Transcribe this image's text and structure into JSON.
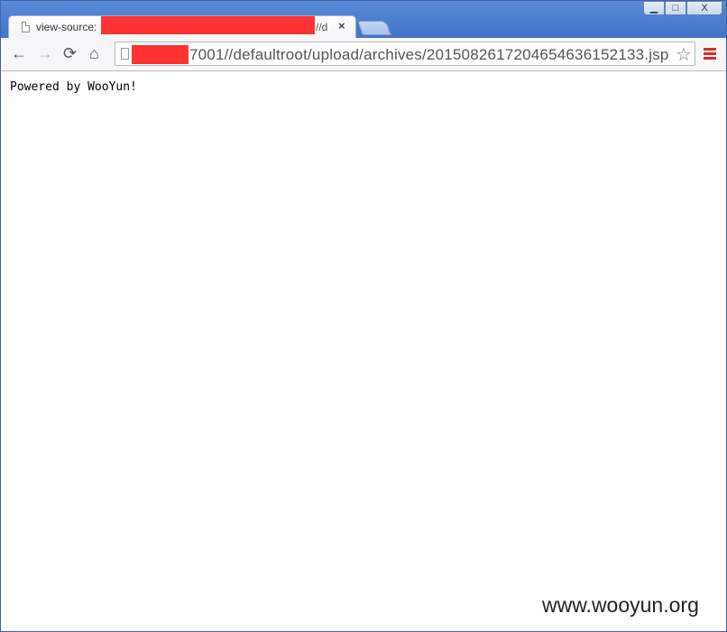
{
  "tab": {
    "title": "view-source:",
    "title_tail": "//d",
    "close_glyph": "×"
  },
  "window_controls": {
    "minimize": "▁",
    "maximize": "□",
    "close": "X"
  },
  "toolbar": {
    "back_glyph": "←",
    "forward_glyph": "→",
    "reload_glyph": "⟳",
    "home_glyph": "⌂",
    "url": "7001//defaultroot/upload/archives/20150826172046546361521​33.jsp",
    "star_glyph": "☆"
  },
  "page": {
    "body_text": "Powered by WooYun!"
  },
  "watermark": {
    "text": "www.wooyun.org"
  },
  "colors": {
    "titlebar": "#4a7ccf",
    "redaction": "#ff3333",
    "menu_icon": "#d32f2f"
  },
  "icons": {
    "tab_icon": "page-icon",
    "back": "arrow-left-icon",
    "forward": "arrow-right-icon",
    "reload": "reload-icon",
    "home": "home-icon",
    "bookmark": "star-icon",
    "menu": "hamburger-menu-icon"
  }
}
